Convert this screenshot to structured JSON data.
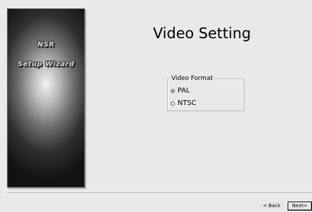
{
  "sidebar": {
    "title": "NSR",
    "subtitle": "Setup Wizard"
  },
  "main": {
    "title": "Video Setting",
    "video_format": {
      "label": "Video Format",
      "options": [
        {
          "label": "PAL",
          "selected": true
        },
        {
          "label": "NTSC",
          "selected": false
        }
      ]
    }
  },
  "footer": {
    "back_label": "< Back",
    "next_label": "Next>"
  }
}
